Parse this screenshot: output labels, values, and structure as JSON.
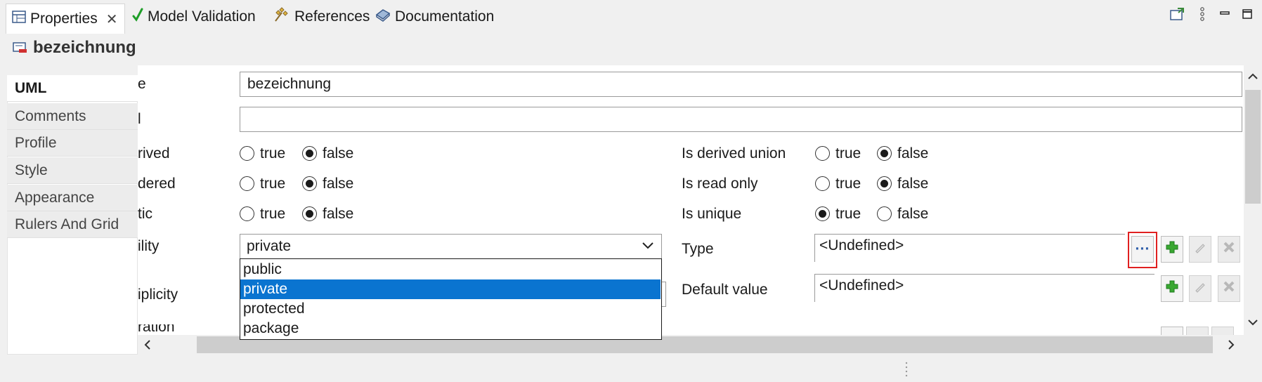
{
  "tabs": [
    {
      "label": "Properties",
      "icon": "properties-icon",
      "close": "✕"
    },
    {
      "label": "Model Validation",
      "icon": "checkmark-icon"
    },
    {
      "label": "References",
      "icon": "references-icon"
    },
    {
      "label": "Documentation",
      "icon": "documentation-icon"
    }
  ],
  "header": {
    "title": "bezeichnung",
    "icon": "property-element-icon"
  },
  "categories": [
    "UML",
    "Comments",
    "Profile",
    "Style",
    "Appearance",
    "Rulers And Grid"
  ],
  "form": {
    "name_label": "e",
    "name_value": "bezeichnung",
    "label_label": "l",
    "label_value": "",
    "derived_label": "rived",
    "ordered_label": "dered",
    "static_label": "tic",
    "visibility_label": "ility",
    "multiplicity_label": "iplicity",
    "cutoff_label": "ration",
    "true_text": "true",
    "false_text": "false",
    "derived_union_label": "Is derived union",
    "read_only_label": "Is read only",
    "unique_label": "Is unique",
    "type_label": "Type",
    "type_value": "<Undefined>",
    "default_value_label": "Default value",
    "default_value_value": "<Undefined>",
    "browse_button": "···",
    "visibility_selected": "private",
    "visibility_options": [
      "public",
      "private",
      "protected",
      "package"
    ]
  },
  "colors": {
    "selection": "#0a74d0",
    "highlight_border": "#e02020",
    "add_green": "#3aa832",
    "check_green": "#1e9e28"
  }
}
